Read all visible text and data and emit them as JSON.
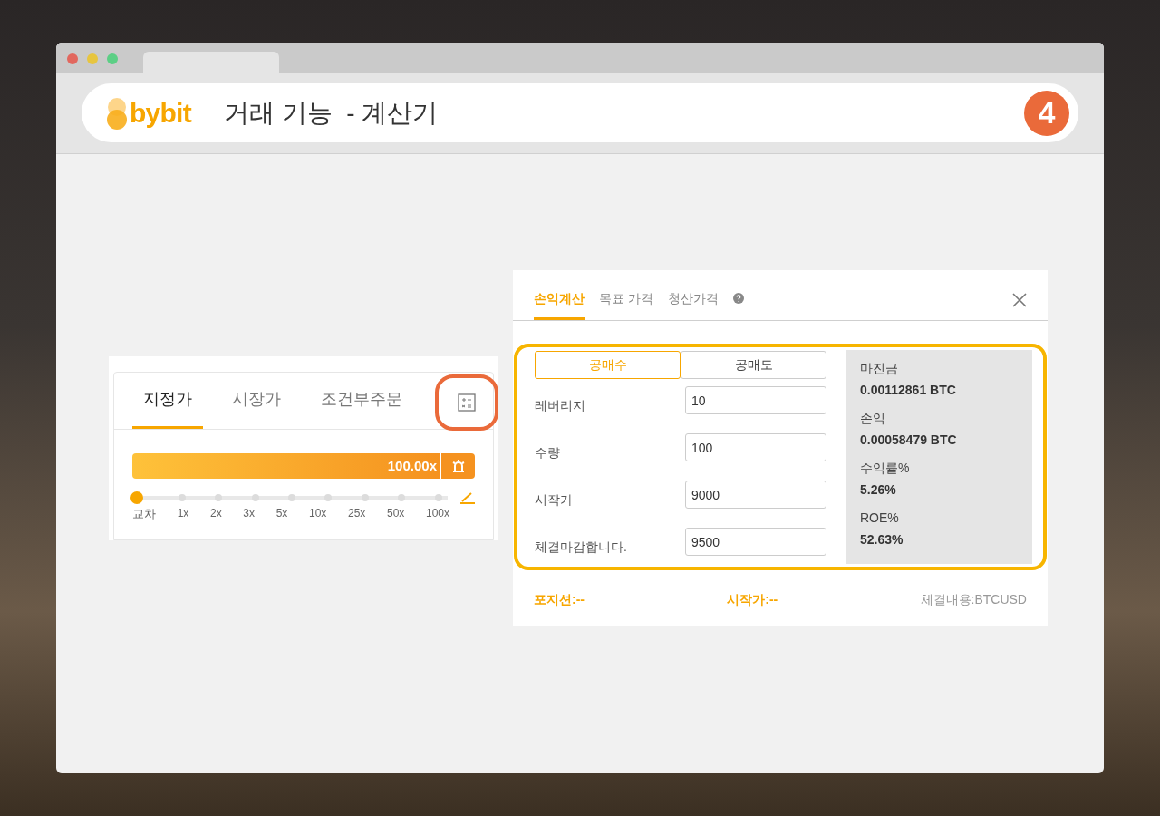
{
  "header": {
    "logo": "bybit",
    "title": "거래 기능  - 계산기",
    "step": "4"
  },
  "order_panel": {
    "tabs": [
      {
        "label": "지정가",
        "selected": true
      },
      {
        "label": "시장가",
        "selected": false
      },
      {
        "label": "조건부주문",
        "selected": false
      }
    ],
    "leverage": {
      "value": "100.00x",
      "level": 0,
      "marks": [
        "교차",
        "1x",
        "2x",
        "3x",
        "5x",
        "10x",
        "25x",
        "50x",
        "100x"
      ]
    }
  },
  "calculator": {
    "tabs": [
      {
        "label": "손익계산",
        "selected": true
      },
      {
        "label": "목표 가격",
        "selected": false
      },
      {
        "label": "청산가격",
        "selected": false
      }
    ],
    "sides": [
      {
        "label": "공매수",
        "selected": true
      },
      {
        "label": "공매도",
        "selected": false
      }
    ],
    "fields": [
      {
        "label": "레버리지",
        "value": "10"
      },
      {
        "label": "수량",
        "value": "100"
      },
      {
        "label": "시작가",
        "value": "9000"
      },
      {
        "label": "체결마감합니다.",
        "value": "9500"
      }
    ],
    "results": [
      {
        "label": "마진금",
        "value": "0.00112861 BTC"
      },
      {
        "label": "손익",
        "value": "0.00058479 BTC"
      },
      {
        "label": "수익률%",
        "value": "5.26%"
      },
      {
        "label": "ROE%",
        "value": "52.63%"
      }
    ],
    "footer": [
      {
        "text": "포지션:--",
        "kind": "accent"
      },
      {
        "text": "시작가:--",
        "kind": "accent"
      },
      {
        "text": "체결내용:BTCUSD",
        "kind": "muted"
      }
    ]
  }
}
